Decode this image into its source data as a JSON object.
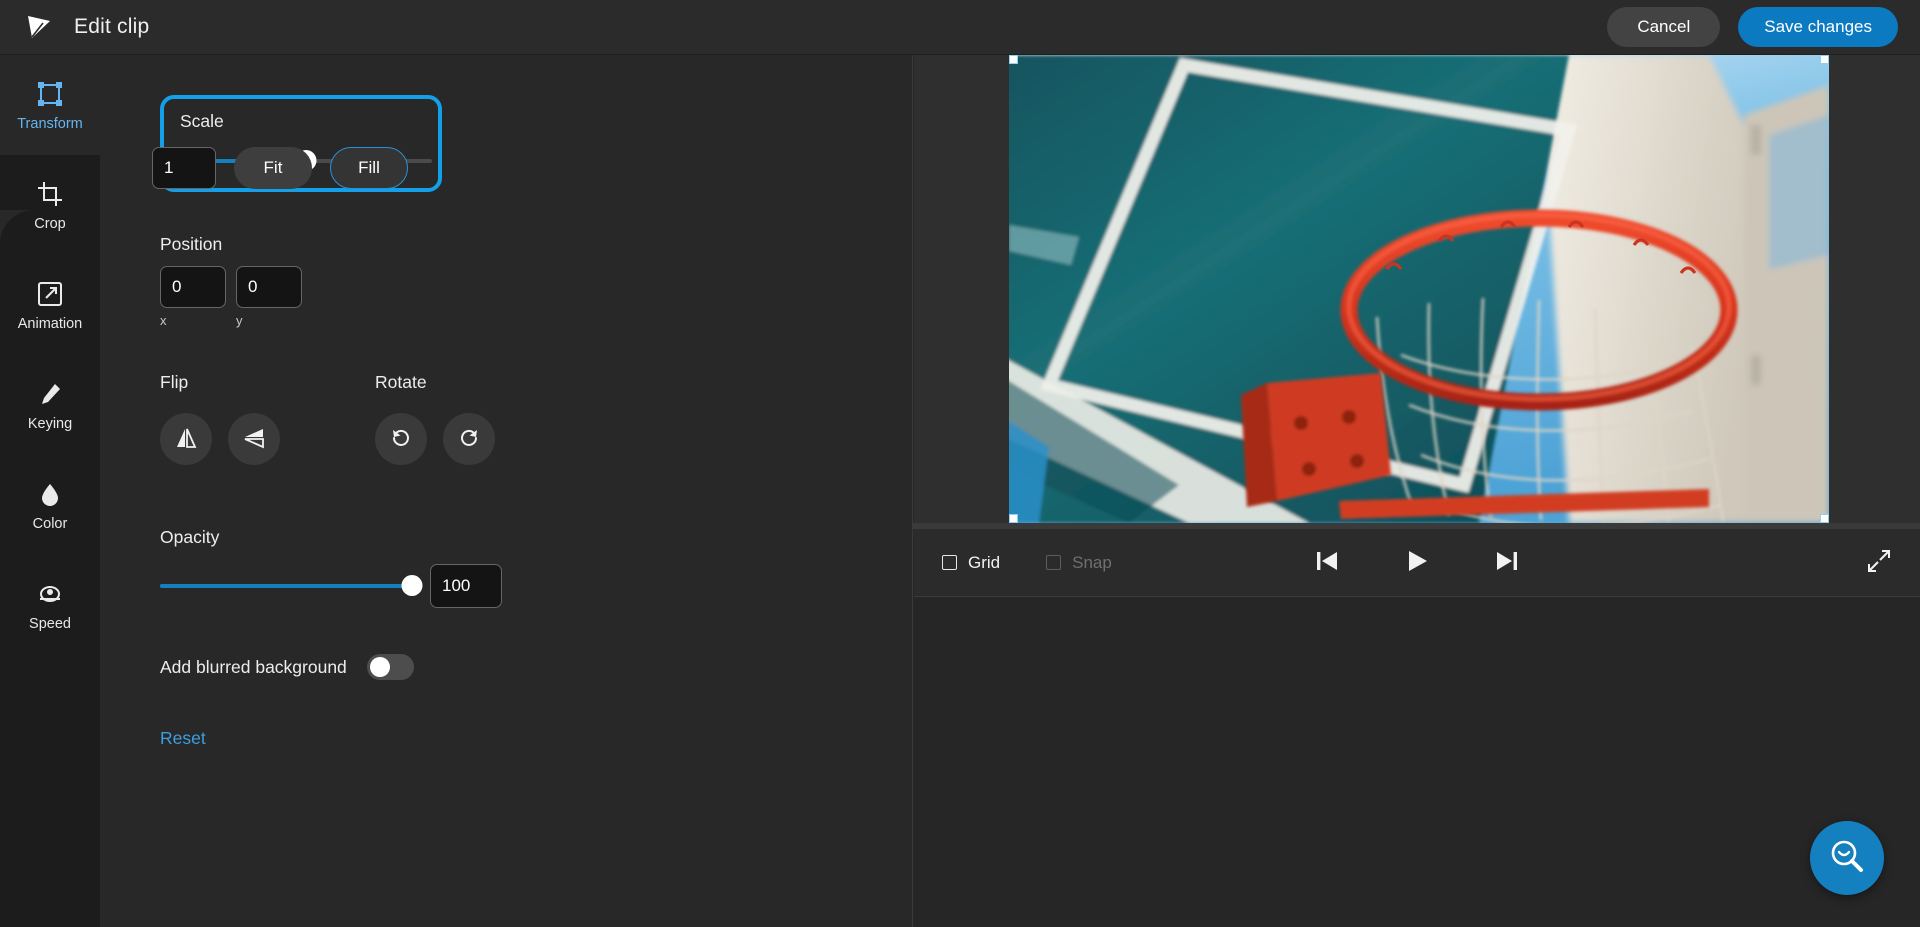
{
  "header": {
    "logo_icon": "app-logo-triangle-icon",
    "title": "Edit clip",
    "cancel_label": "Cancel",
    "save_label": "Save changes",
    "accent_color": "#0b7ac0"
  },
  "sidebar": {
    "items": [
      {
        "label": "Transform",
        "icon": "transform-icon",
        "active": true
      },
      {
        "label": "Crop",
        "icon": "crop-icon",
        "active": false
      },
      {
        "label": "Animation",
        "icon": "animation-icon",
        "active": false
      },
      {
        "label": "Keying",
        "icon": "eyedropper-icon",
        "active": false
      },
      {
        "label": "Color",
        "icon": "droplet-icon",
        "active": false
      },
      {
        "label": "Speed",
        "icon": "speedometer-icon",
        "active": false
      }
    ],
    "active_color": "#64b5f0"
  },
  "transform": {
    "scale": {
      "label": "Scale",
      "value": "1",
      "slider_percent": 50,
      "highlight_color": "#13a0e8",
      "fit_label": "Fit",
      "fill_label": "Fill",
      "selected_mode": "Fill"
    },
    "position": {
      "label": "Position",
      "x_value": "0",
      "y_value": "0",
      "x_axis_label": "x",
      "y_axis_label": "y"
    },
    "flip": {
      "label": "Flip",
      "horizontal_icon": "flip-horizontal-icon",
      "vertical_icon": "flip-vertical-icon"
    },
    "rotate": {
      "label": "Rotate",
      "ccw_icon": "rotate-counterclockwise-icon",
      "cw_icon": "rotate-clockwise-icon"
    },
    "opacity": {
      "label": "Opacity",
      "value": "100",
      "slider_percent": 100
    },
    "blurred_background": {
      "label": "Add blurred background",
      "enabled": false
    },
    "reset_label": "Reset"
  },
  "preview": {
    "grid_label": "Grid",
    "grid_checked": false,
    "snap_label": "Snap",
    "snap_checked": false,
    "snap_disabled": true,
    "skip_back_icon": "skip-back-icon",
    "play_icon": "play-icon",
    "skip_forward_icon": "skip-forward-icon",
    "expand_icon": "expand-fullscreen-icon",
    "clip_content": "basketball hoop with red rim, white net and teal backboard against blue sky"
  },
  "help": {
    "icon": "search-smile-icon",
    "color": "#1580bf"
  }
}
